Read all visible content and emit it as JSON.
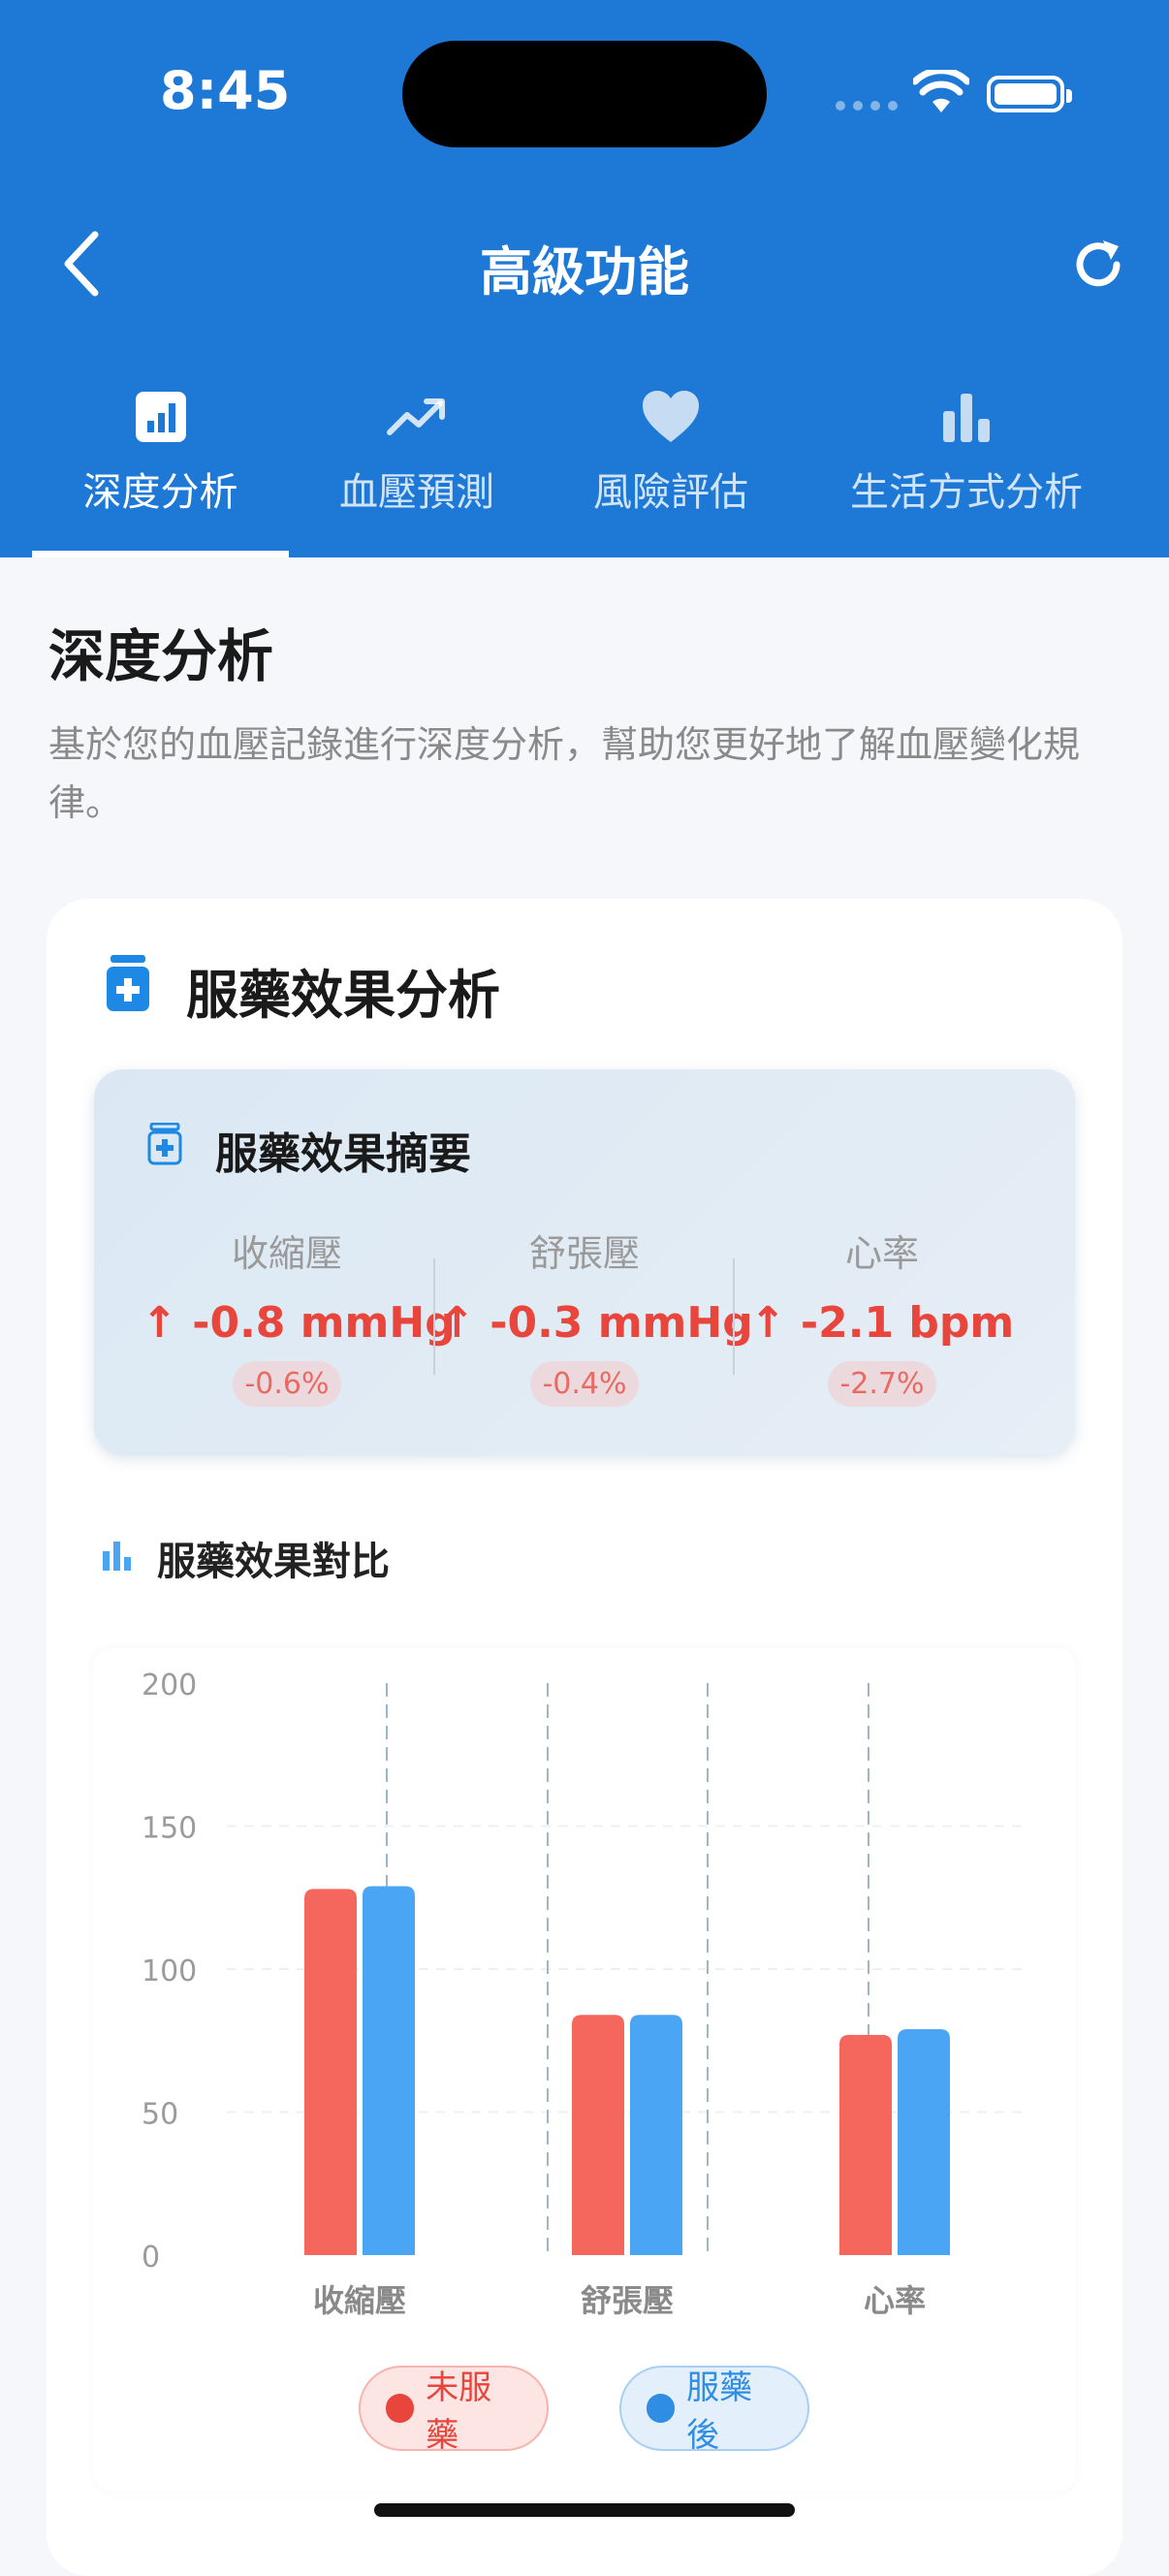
{
  "status": {
    "time": "8:45"
  },
  "header": {
    "title": "高級功能"
  },
  "tabs": [
    {
      "label": "深度分析",
      "icon": "chart-square-icon",
      "active": true
    },
    {
      "label": "血壓預測",
      "icon": "trend-up-icon",
      "active": false
    },
    {
      "label": "風險評估",
      "icon": "heart-icon",
      "active": false
    },
    {
      "label": "生活方式分析",
      "icon": "bar-chart-icon",
      "active": false
    }
  ],
  "section": {
    "title": "深度分析",
    "description": "基於您的血壓記錄進行深度分析，幫助您更好地了解血壓變化規律。"
  },
  "card": {
    "title": "服藥效果分析",
    "summary": {
      "title": "服藥效果摘要",
      "metrics": [
        {
          "name": "收縮壓",
          "value": "-0.8 mmHg",
          "pct": "-0.6%"
        },
        {
          "name": "舒張壓",
          "value": "-0.3 mmHg",
          "pct": "-0.4%"
        },
        {
          "name": "心率",
          "value": "-2.1 bpm",
          "pct": "-2.7%"
        }
      ]
    },
    "comparison_title": "服藥效果對比",
    "legend": {
      "before": "未服藥",
      "after": "服藥後"
    }
  },
  "colors": {
    "primary": "#1e78d6",
    "before": "#f5675c",
    "after": "#4aa6f5",
    "negative": "#e8453c"
  },
  "chart_data": {
    "type": "bar",
    "categories": [
      "收縮壓",
      "舒張壓",
      "心率"
    ],
    "series": [
      {
        "name": "未服藥",
        "values": [
          128,
          84,
          77
        ]
      },
      {
        "name": "服藥後",
        "values": [
          129,
          84,
          79
        ]
      }
    ],
    "ylim": [
      0,
      200
    ],
    "yticks": [
      0,
      50,
      100,
      150,
      200
    ],
    "grid": true,
    "legend_position": "bottom"
  }
}
